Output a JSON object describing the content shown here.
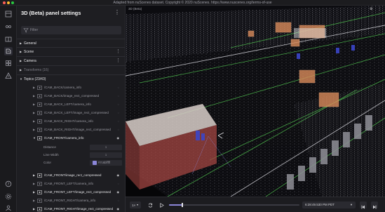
{
  "window": {
    "title": "Adapted from nuScenes dataset. Copyright © 2020 nuScenes. https://www.nuscenes.org/terms-of-use"
  },
  "panel": {
    "title": "3D (Beta) panel settings",
    "menu_icon": "more-vertical-icon",
    "filter_placeholder": "Filter"
  },
  "sections": [
    {
      "label": "General",
      "has_menu": false
    },
    {
      "label": "Scene",
      "has_menu": true
    },
    {
      "label": "Camera",
      "has_menu": true
    },
    {
      "label": "Transforms (16)",
      "has_menu": false,
      "dim": true
    },
    {
      "label": "Topics (23/43)",
      "has_menu": false
    }
  ],
  "topics": [
    {
      "name": "/CAM_BACK/camera_info",
      "bright": false
    },
    {
      "name": "/CAM_BACK/image_rect_compressed",
      "bright": false
    },
    {
      "name": "/CAM_BACK_LEFT/camera_info",
      "bright": false
    },
    {
      "name": "/CAM_BACK_LEFT/image_rect_compressed",
      "bright": false
    },
    {
      "name": "/CAM_BACK_RIGHT/camera_info",
      "bright": false
    },
    {
      "name": "/CAM_BACK_RIGHT/image_rect_compressed",
      "bright": false
    },
    {
      "name": "/CAM_FRONT/camera_info",
      "bright": true,
      "expanded": true
    }
  ],
  "camera_info_props": {
    "distance_label": "Distance",
    "distance_value": "1",
    "line_width_label": "Line Width",
    "line_width_value": "1",
    "color_label": "Color",
    "color_value": "#7c6bfffff",
    "color_swatch": "#8b86d8"
  },
  "topics_after": [
    {
      "name": "/CAM_FRONT/image_rect_compressed",
      "bright": true
    },
    {
      "name": "/CAM_FRONT_LEFT/camera_info",
      "bright": false
    },
    {
      "name": "/CAM_FRONT_LEFT/image_rect_compressed",
      "bright": true
    },
    {
      "name": "/CAM_FRONT_RIGHT/camera_info",
      "bright": false
    },
    {
      "name": "/CAM_FRONT_RIGHT/image_rect_compressed",
      "bright": true
    }
  ],
  "scene": {
    "label": "3D (Beta)"
  },
  "playback": {
    "speed": "1×",
    "time": "6:28:49.530 PM PDT",
    "progress": 0.1,
    "accent": "#8b86d8"
  }
}
